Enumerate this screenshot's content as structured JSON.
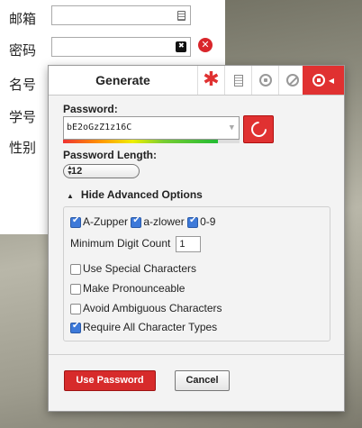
{
  "form": {
    "email_label": "邮箱",
    "password_label": "密码",
    "name_label": "名号",
    "studentid_label": "学号",
    "gender_label": "性别",
    "colors": {
      "error": "#d9262b"
    }
  },
  "popup": {
    "title": "Generate",
    "tab_icons": [
      "asterisk-icon",
      "notebook-icon",
      "lock-icon",
      "block-icon",
      "lastpass-icon"
    ],
    "password_label": "Password:",
    "password_value": "bE2oGzZ1z16C",
    "strength_fraction": 0.88,
    "length_label": "Password Length:",
    "length_value": "12",
    "toggle_label": "Hide Advanced Options",
    "options": {
      "uppercase": {
        "label": "A-Zupper",
        "checked": true
      },
      "lowercase": {
        "label": "a-zlower",
        "checked": true
      },
      "digits": {
        "label": "0-9",
        "checked": true
      },
      "min_digit_label": "Minimum Digit Count",
      "min_digit_value": "1",
      "special": {
        "label": "Use Special Characters",
        "checked": false
      },
      "pronounceable": {
        "label": "Make Pronounceable",
        "checked": false
      },
      "ambiguous": {
        "label": "Avoid Ambiguous Characters",
        "checked": false
      },
      "all_types": {
        "label": "Require All Character Types",
        "checked": true
      }
    },
    "use_button": "Use Password",
    "cancel_button": "Cancel",
    "colors": {
      "accent": "#e03131",
      "checkbox": "#3d79d9"
    }
  }
}
